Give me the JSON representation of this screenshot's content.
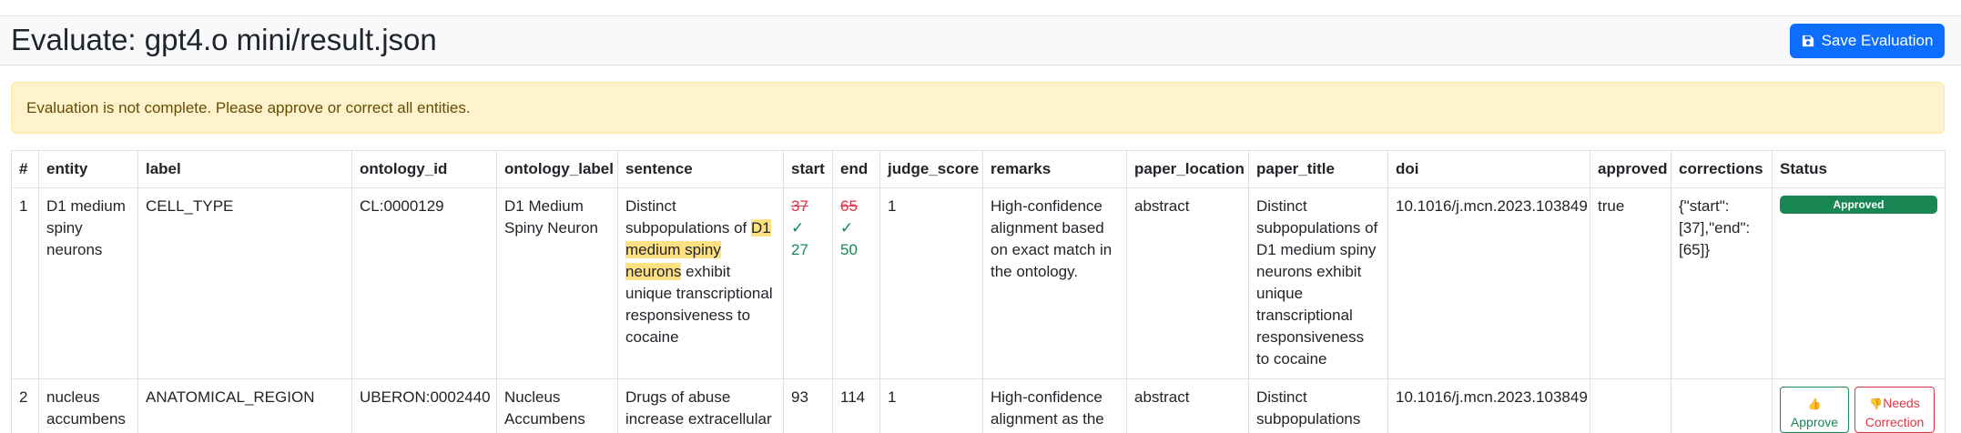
{
  "header": {
    "title": "Evaluate: gpt4.o mini/result.json",
    "save_label": "Save Evaluation",
    "save_icon": "floppy-disk-icon"
  },
  "alert": {
    "message": "Evaluation is not complete. Please approve or correct all entities."
  },
  "table": {
    "columns": [
      "#",
      "entity",
      "label",
      "ontology_id",
      "ontology_label",
      "sentence",
      "start",
      "end",
      "judge_score",
      "remarks",
      "paper_location",
      "paper_title",
      "doi",
      "approved",
      "corrections",
      "Status"
    ],
    "rows": [
      {
        "index": "1",
        "entity": "D1 medium spiny neurons",
        "label": "CELL_TYPE",
        "ontology_id": "CL:0000129",
        "ontology_label": "D1 Medium Spiny Neuron",
        "sentence_before": "Distinct subpopulations of ",
        "sentence_highlight": "D1 medium spiny neurons",
        "sentence_after": " exhibit unique transcriptional responsiveness to cocaine",
        "start_old": "37",
        "start_new": "27",
        "end_old": "65",
        "end_new": "50",
        "check": "✓",
        "judge_score": "1",
        "remarks": "High-confidence alignment based on exact match in the ontology.",
        "paper_location": "abstract",
        "paper_title": "Distinct subpopulations of D1 medium spiny neurons exhibit unique transcriptional responsiveness to cocaine",
        "doi": "10.1016/j.mcn.2023.103849",
        "approved": "true",
        "corrections": "{\"start\": [37],\"end\": [65]}",
        "status": "Approved"
      },
      {
        "index": "2",
        "entity": "nucleus accumbens",
        "label": "ANATOMICAL_REGION",
        "ontology_id": "UBERON:0002440",
        "ontology_label": "Nucleus Accumbens",
        "sentence": "Drugs of abuse increase extracellular",
        "start": "93",
        "end": "114",
        "judge_score": "1",
        "remarks": "High-confidence alignment as the",
        "paper_location": "abstract",
        "paper_title": "Distinct subpopulations",
        "doi": "10.1016/j.mcn.2023.103849",
        "approved": "",
        "corrections": "",
        "approve_label": "Approve",
        "approve_icon": "thumbs-up-icon",
        "correct_label": "Needs Correction",
        "correct_icon": "thumbs-down-icon"
      }
    ]
  },
  "colors": {
    "primary": "#0d6efd",
    "success": "#198754",
    "danger": "#dc3545",
    "warning_bg": "#fff3cd",
    "highlight": "#ffe083"
  }
}
